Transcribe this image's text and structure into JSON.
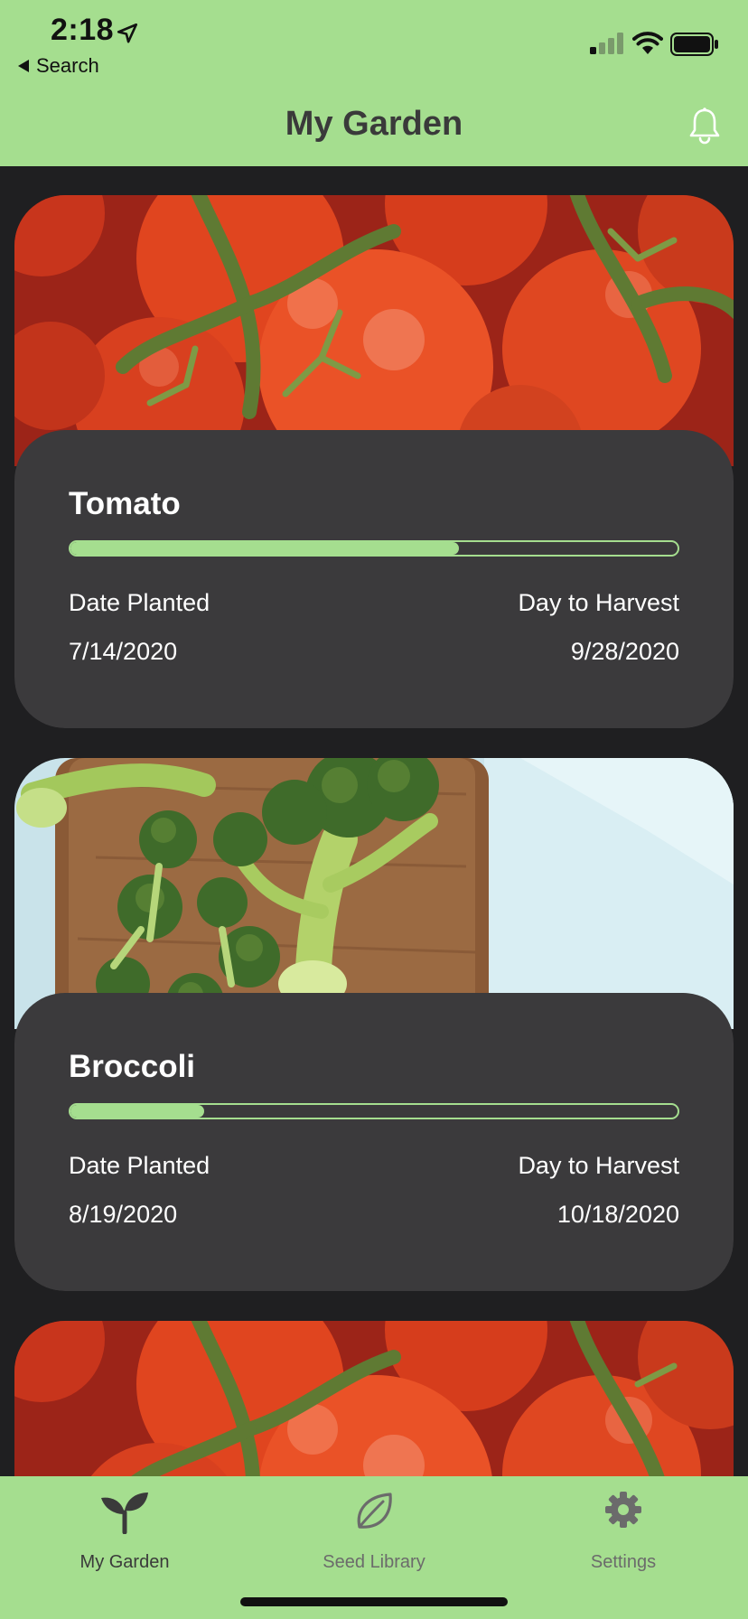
{
  "status_bar": {
    "time": "2:18",
    "back_label": "Search"
  },
  "header": {
    "title": "My Garden",
    "notification_icon": "bell-icon"
  },
  "colors": {
    "accent": "#a5de8f",
    "card_bg": "#3b3a3c",
    "screen_bg": "#1f1f21"
  },
  "plants": [
    {
      "name": "Tomato",
      "image": "tomato-photo",
      "progress": 0.64,
      "planted_label": "Date Planted",
      "planted_date": "7/14/2020",
      "harvest_label": "Day to Harvest",
      "harvest_date": "9/28/2020"
    },
    {
      "name": "Broccoli",
      "image": "broccoli-photo",
      "progress": 0.22,
      "planted_label": "Date Planted",
      "planted_date": "8/19/2020",
      "harvest_label": "Day to Harvest",
      "harvest_date": "10/18/2020"
    },
    {
      "image": "tomato-photo"
    }
  ],
  "tabs": [
    {
      "label": "My Garden",
      "icon": "sprout-icon",
      "active": true
    },
    {
      "label": "Seed Library",
      "icon": "leaf-icon",
      "active": false
    },
    {
      "label": "Settings",
      "icon": "gear-icon",
      "active": false
    }
  ]
}
